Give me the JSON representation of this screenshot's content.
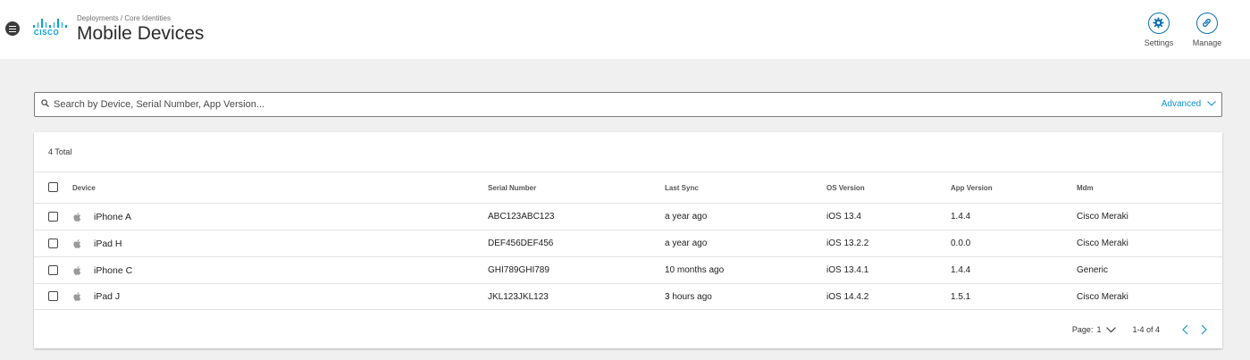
{
  "header": {
    "breadcrumb": "Deployments / Core Identities",
    "title": "Mobile Devices",
    "logo_text": "CISCO",
    "actions": {
      "settings": "Settings",
      "manage": "Manage"
    }
  },
  "search": {
    "placeholder": "Search by Device, Serial Number, App Version...",
    "advanced": "Advanced"
  },
  "table": {
    "total": "4 Total",
    "columns": {
      "device": "Device",
      "serial": "Serial Number",
      "sync": "Last Sync",
      "os": "OS Version",
      "app": "App Version",
      "mdm": "Mdm"
    },
    "rows": [
      {
        "device": "iPhone A",
        "serial": "ABC123ABC123",
        "sync": "a year ago",
        "os": "iOS 13.4",
        "app": "1.4.4",
        "mdm": "Cisco Meraki"
      },
      {
        "device": "iPad H",
        "serial": "DEF456DEF456",
        "sync": "a year ago",
        "os": "iOS 13.2.2",
        "app": "0.0.0",
        "mdm": "Cisco Meraki"
      },
      {
        "device": "iPhone C",
        "serial": "GHI789GHI789",
        "sync": "10 months ago",
        "os": "iOS 13.4.1",
        "app": "1.4.4",
        "mdm": "Generic"
      },
      {
        "device": "iPad J",
        "serial": "JKL123JKL123",
        "sync": "3 hours ago",
        "os": "iOS 14.4.2",
        "app": "1.5.1",
        "mdm": "Cisco Meraki"
      }
    ]
  },
  "pagination": {
    "page_label": "Page:",
    "page_value": "1",
    "range": "1-4 of 4"
  },
  "colors": {
    "accent": "#049fd9",
    "link": "#0d8fd0",
    "icon_ring": "#0d6fb5"
  },
  "icons": [
    "menu-icon",
    "cisco-logo",
    "gear-icon",
    "link-icon",
    "search-icon",
    "chevron-down-icon",
    "apple-icon",
    "chevron-left-icon",
    "chevron-right-icon"
  ]
}
